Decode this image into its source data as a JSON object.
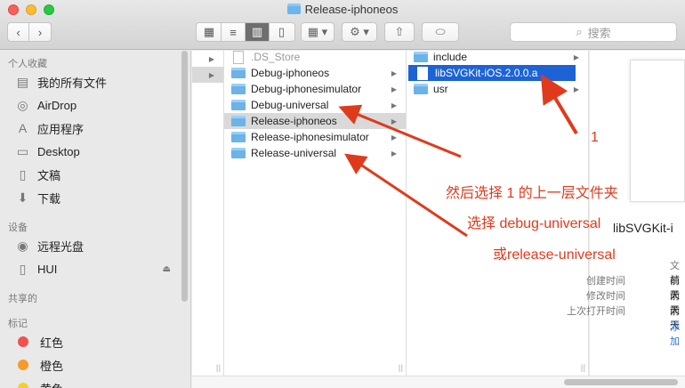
{
  "window": {
    "title": "Release-iphoneos"
  },
  "toolbar": {
    "search_placeholder": "搜索"
  },
  "sidebar": {
    "favorites_header": "个人收藏",
    "favorites": [
      {
        "label": "我的所有文件",
        "icon": "all-files-icon"
      },
      {
        "label": "AirDrop",
        "icon": "airdrop-icon"
      },
      {
        "label": "应用程序",
        "icon": "applications-icon"
      },
      {
        "label": "Desktop",
        "icon": "desktop-icon"
      },
      {
        "label": "文稿",
        "icon": "documents-icon"
      },
      {
        "label": "下载",
        "icon": "downloads-icon"
      }
    ],
    "devices_header": "设备",
    "devices": [
      {
        "label": "远程光盘",
        "icon": "remote-disc-icon"
      },
      {
        "label": "HUI",
        "icon": "drive-icon"
      }
    ],
    "shared_header": "共享的",
    "tags_header": "标记",
    "tags": [
      {
        "label": "红色",
        "color": "#f0524f"
      },
      {
        "label": "橙色",
        "color": "#f69a2c"
      },
      {
        "label": "黄色",
        "color": "#f5cf2c"
      }
    ]
  },
  "column2": [
    {
      "name": ".DS_Store",
      "type": "file"
    },
    {
      "name": "Debug-iphoneos",
      "type": "folder"
    },
    {
      "name": "Debug-iphonesimulator",
      "type": "folder"
    },
    {
      "name": "Debug-universal",
      "type": "folder"
    },
    {
      "name": "Release-iphoneos",
      "type": "folder"
    },
    {
      "name": "Release-iphonesimulator",
      "type": "folder"
    },
    {
      "name": "Release-universal",
      "type": "folder"
    }
  ],
  "column3": [
    {
      "name": "include",
      "type": "folder"
    },
    {
      "name": "libSVGKit-iOS.2.0.0.a",
      "type": "file"
    },
    {
      "name": "usr",
      "type": "folder"
    }
  ],
  "preview": {
    "name": "libSVGKit-i",
    "kind": "文档",
    "created_label": "创建时间",
    "modified_label": "修改时间",
    "opened_label": "上次打开时间",
    "created_value": "前天",
    "modified_value": "前天",
    "opened_value": "前天",
    "more": "添加"
  },
  "annotations": {
    "number": "1",
    "line1": "然后选择 1 的上一层文件夹",
    "line2": "选择 debug-universal",
    "line3": "或release-universal"
  },
  "colors": {
    "annotation": "#e03a1d",
    "selection": "#1d63d6",
    "folder": "#6cb3e8"
  }
}
